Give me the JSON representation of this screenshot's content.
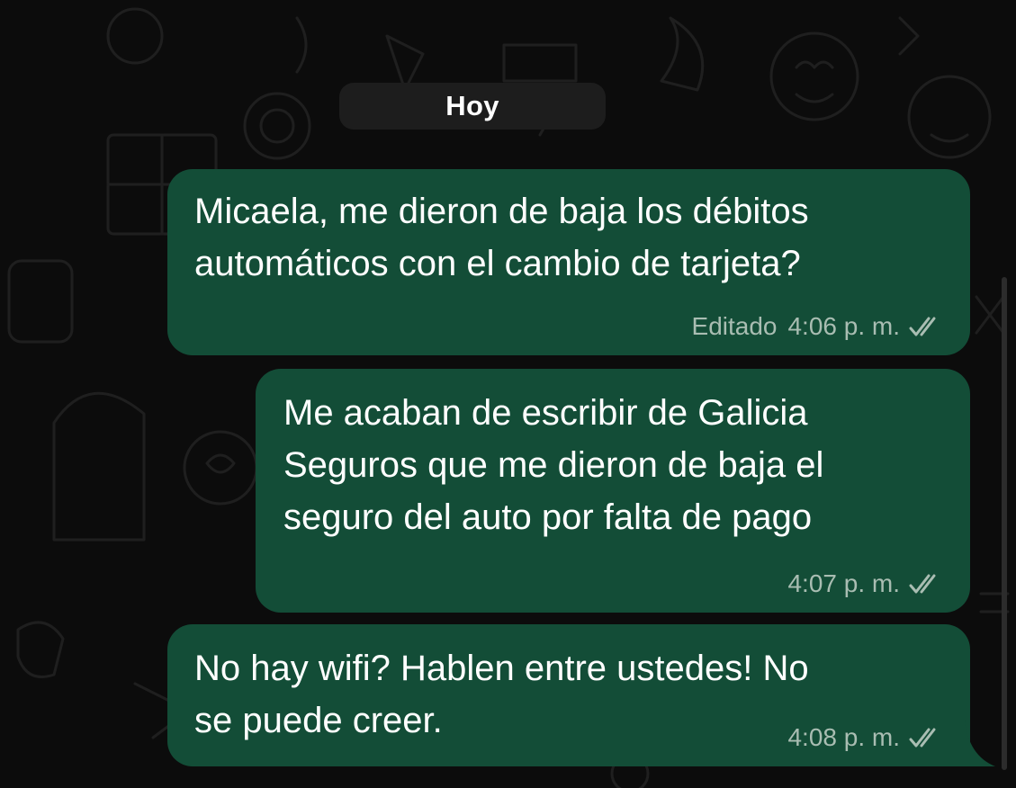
{
  "date_divider": "Hoy",
  "messages": [
    {
      "text": "Micaela, me dieron de baja los débitos\nautomáticos con el cambio de tarjeta?",
      "edited_label": "Editado",
      "time": "4:06 p. m.",
      "status": "read-double-check-icon"
    },
    {
      "text": "Me acaban de escribir de Galicia\nSeguros que me dieron de baja el\nseguro del auto por falta de pago",
      "time": "4:07 p. m.",
      "status": "read-double-check-icon"
    },
    {
      "text": "No hay wifi? Hablen entre ustedes! No\nse puede creer.",
      "time": "4:08 p. m.",
      "status": "read-double-check-icon"
    }
  ],
  "colors": {
    "background": "#0c0c0c",
    "outgoing_bubble": "#134d37",
    "meta_text": "#a9bdb2",
    "date_chip": "#1d1d1d"
  }
}
